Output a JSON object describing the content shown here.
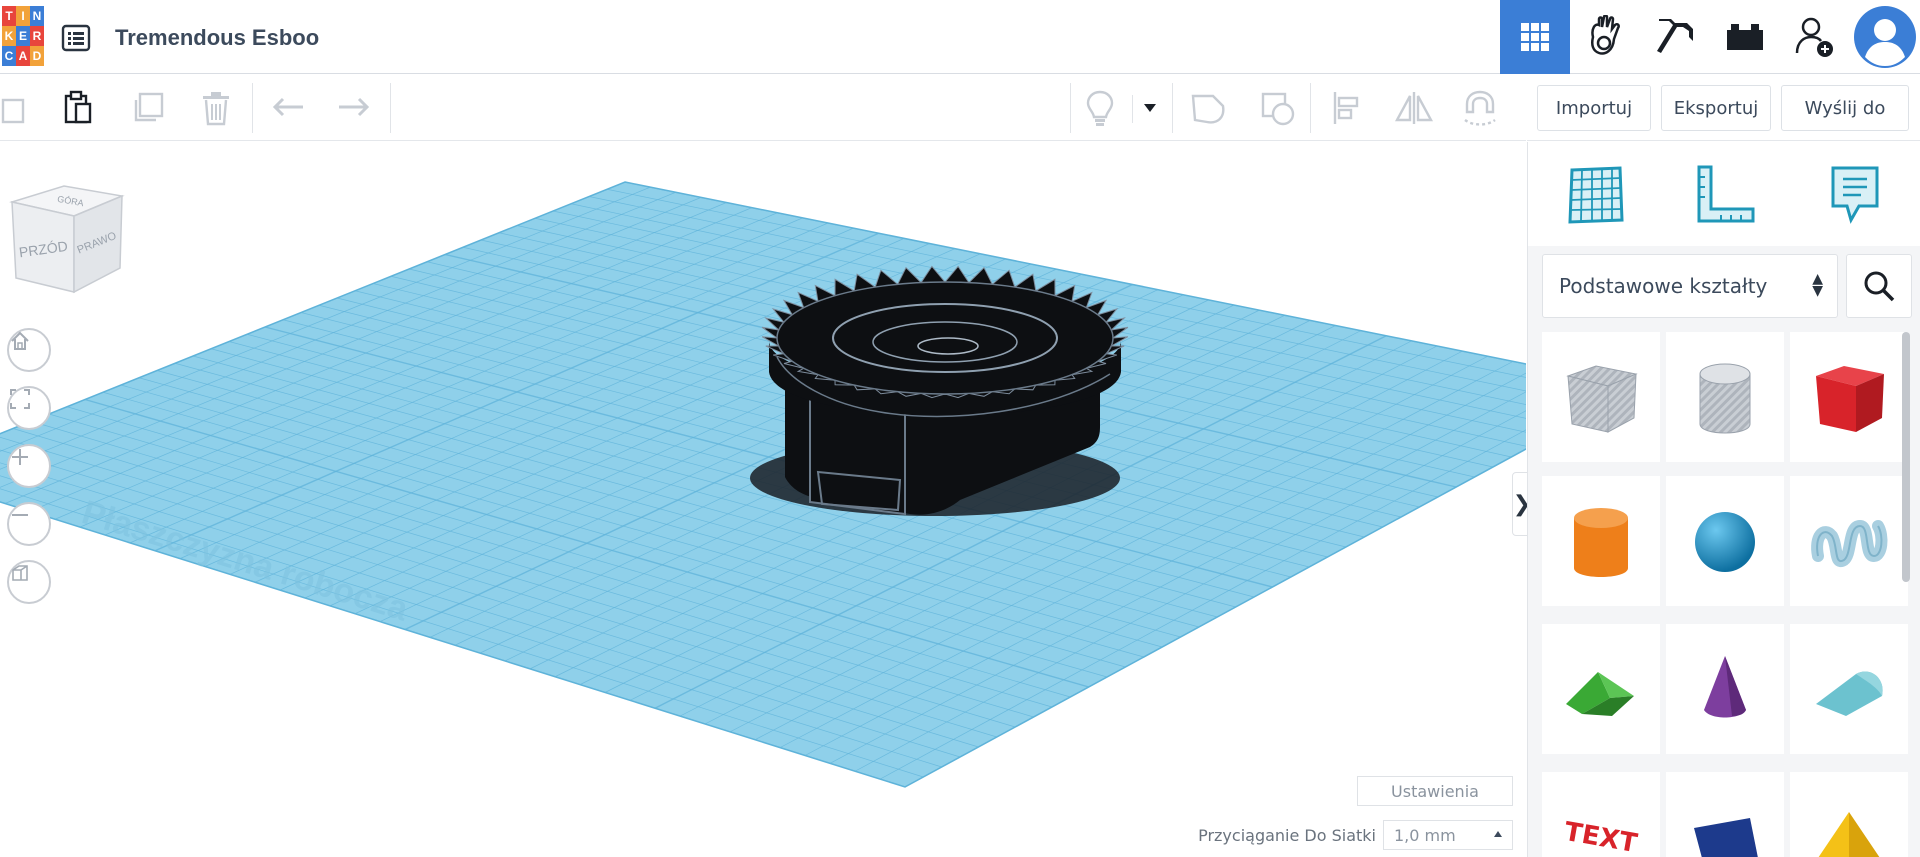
{
  "header": {
    "logo_letters": [
      "T",
      "I",
      "N",
      "K",
      "E",
      "R",
      "C",
      "A",
      "D"
    ],
    "logo_colors": [
      "#e8453c",
      "#f2a23a",
      "#3b7ed6",
      "#f2a23a",
      "#3b7ed6",
      "#e8453c",
      "#3b7ed6",
      "#e8453c",
      "#f2a23a"
    ],
    "project_title": "Tremendous Esboo",
    "menu_icon": "list-icon",
    "icons": [
      "grid-view-icon",
      "gallery-hand-icon",
      "pickaxe-icon",
      "brick-icon",
      "add-user-icon",
      "avatar-icon"
    ],
    "active_color": "#3b7ed6"
  },
  "toolbar": {
    "icons": [
      "copy-icon",
      "paste-icon",
      "duplicate-icon",
      "delete-icon",
      "undo-icon",
      "redo-icon",
      "light-bulb-icon",
      "dropdown-caret-icon",
      "shape-solid-icon",
      "shape-hole-icon",
      "align-icon",
      "mirror-icon",
      "magnet-icon"
    ],
    "import_label": "Importuj",
    "export_label": "Eksportuj",
    "send_label": "Wyślij do"
  },
  "viewcube": {
    "front_label": "PRZÓD",
    "right_label": "PRAWO",
    "top_label": "GÓRA"
  },
  "view_controls": [
    "home-icon",
    "fit-view-icon",
    "zoom-in-icon",
    "zoom-out-icon",
    "perspective-icon"
  ],
  "workplane": {
    "label": "Płaszczyzna robocza",
    "grid_color": "#8fd0ea",
    "grid_line_color": "#5fb3d9",
    "object_color": "#0d0f12"
  },
  "footer": {
    "settings_label": "Ustawienia",
    "snap_label": "Przyciąganie Do Siatki",
    "snap_value": "1,0 mm"
  },
  "panel": {
    "tools": [
      "workplane-icon",
      "ruler-icon",
      "notes-icon"
    ],
    "library_label": "Podstawowe kształty",
    "search_icon": "search-icon",
    "shapes": [
      {
        "name": "box-hole",
        "color": "#b9bec6"
      },
      {
        "name": "cylinder-hole",
        "color": "#c6cad0"
      },
      {
        "name": "box",
        "color": "#d8232a"
      },
      {
        "name": "cylinder",
        "color": "#ee7f1a"
      },
      {
        "name": "sphere",
        "color": "#1b9ad2"
      },
      {
        "name": "scribble",
        "color": "#a9cfe0"
      },
      {
        "name": "roof",
        "color": "#3aa935"
      },
      {
        "name": "cone",
        "color": "#7d3e9e"
      },
      {
        "name": "round-roof",
        "color": "#6cc2cf"
      },
      {
        "name": "text",
        "color": "#d8232a"
      },
      {
        "name": "wedge",
        "color": "#1d3a8c"
      },
      {
        "name": "pyramid",
        "color": "#f4c117"
      }
    ]
  }
}
